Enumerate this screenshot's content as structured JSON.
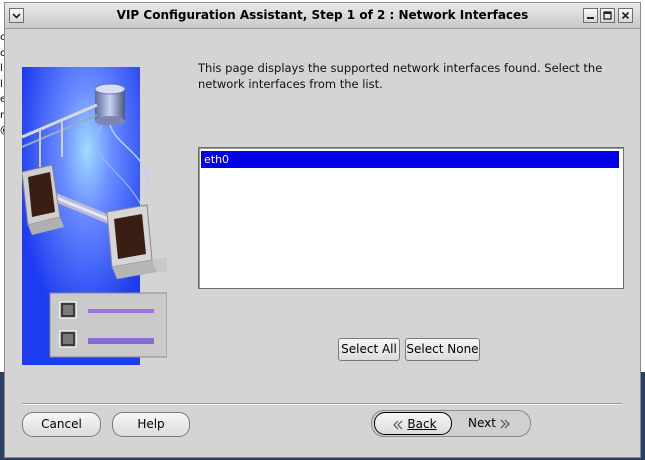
{
  "window": {
    "title": "VIP Configuration Assistant, Step 1 of 2 : Network Interfaces",
    "icons": [
      "window-menu-icon",
      "minimize-icon",
      "maximize-icon",
      "close-icon"
    ]
  },
  "background_chars": [
    "c",
    "o",
    "l",
    "l",
    "e",
    "r",
    "@"
  ],
  "main": {
    "description": "This page displays the supported network interfaces found. Select the network interfaces from the list.",
    "interfaces": [
      {
        "name": "eth0",
        "selected": true
      }
    ],
    "select_all_label": "Select All",
    "select_none_label": "Select None"
  },
  "footer": {
    "cancel_label": "Cancel",
    "help_label": "Help",
    "back_label": "Back",
    "next_label": "Next"
  },
  "colors": {
    "selection": "#0000e6",
    "art_blue": "#1d3cf0",
    "window_bg": "#d4d4d4"
  }
}
